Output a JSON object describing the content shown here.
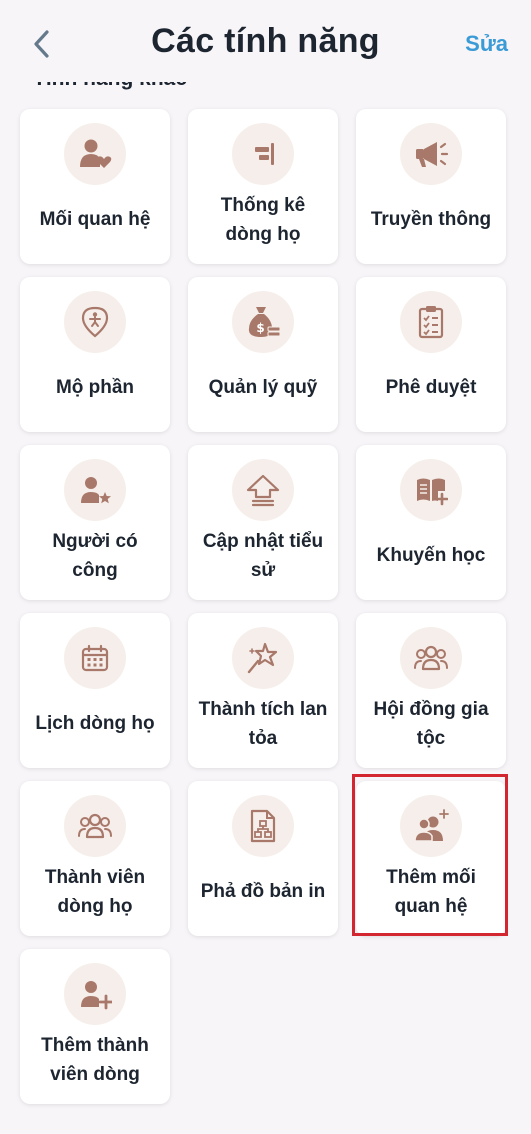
{
  "header": {
    "title": "Các tính năng",
    "edit_label": "Sửa"
  },
  "section": {
    "title": "Tính năng khác"
  },
  "features": [
    {
      "label": "Mối quan hệ",
      "icon": "relationship-icon"
    },
    {
      "label": "Thống kê dòng họ",
      "icon": "statistics-icon"
    },
    {
      "label": "Truyền thông",
      "icon": "megaphone-icon"
    },
    {
      "label": "Mộ phần",
      "icon": "grave-location-icon"
    },
    {
      "label": "Quản lý quỹ",
      "icon": "money-bag-icon"
    },
    {
      "label": "Phê duyệt",
      "icon": "clipboard-checklist-icon"
    },
    {
      "label": "Người có công",
      "icon": "person-star-icon"
    },
    {
      "label": "Cập nhật tiểu sử",
      "icon": "upload-arrow-icon"
    },
    {
      "label": "Khuyến học",
      "icon": "book-plus-icon"
    },
    {
      "label": "Lịch dòng họ",
      "icon": "calendar-icon"
    },
    {
      "label": "Thành tích lan tỏa",
      "icon": "sparkle-star-icon"
    },
    {
      "label": "Hội đồng gia tộc",
      "icon": "council-group-icon"
    },
    {
      "label": "Thành viên dòng họ",
      "icon": "members-group-icon"
    },
    {
      "label": "Phả đồ bản in",
      "icon": "family-tree-document-icon"
    },
    {
      "label": "Thêm mối quan hệ",
      "icon": "add-relationship-icon"
    },
    {
      "label": "Thêm thành viên dòng",
      "icon": "add-member-icon"
    }
  ],
  "colors": {
    "icon": "#a8796a",
    "icon_bg": "#f6eeea",
    "accent": "#3a9bd6",
    "highlight": "#d22630"
  }
}
